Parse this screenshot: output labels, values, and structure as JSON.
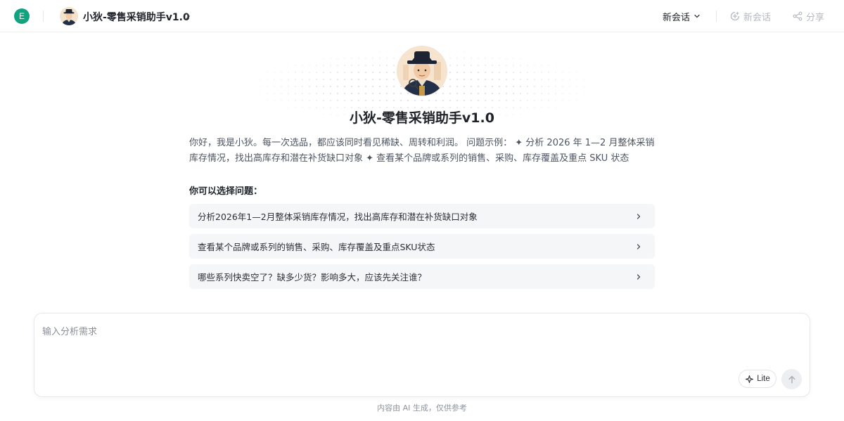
{
  "workspace": {
    "avatar_letter": "E",
    "accent": "#10a37f"
  },
  "bot": {
    "name": "小狄-零售采销助手v1.0"
  },
  "header": {
    "new_chat_dropdown_label": "新会话",
    "new_chat_button_label": "新会话",
    "share_label": "分享"
  },
  "hero": {
    "title": "小狄-零售采销助手v1.0",
    "intro": "你好，我是小狄。每一次选品，都应该同时看见稀缺、周转和利润。 问题示例： ✦ 分析 2026 年 1—2 月整体采销库存情况，找出高库存和潜在补货缺口对象 ✦ 查看某个品牌或系列的销售、采购、库存覆盖及重点 SKU 状态"
  },
  "questions": {
    "heading": "你可以选择问题：",
    "items": [
      {
        "label": "分析2026年1—2月整体采销库存情况，找出高库存和潜在补货缺口对象"
      },
      {
        "label": "查看某个品牌或系列的销售、采购、库存覆盖及重点SKU状态"
      },
      {
        "label": "哪些系列快卖空了？缺多少货？影响多大，应该先关注谁？"
      }
    ]
  },
  "composer": {
    "placeholder": "输入分析需求",
    "value": "",
    "mode_label": "Lite"
  },
  "footer": {
    "note": "内容由 AI 生成，仅供参考"
  },
  "icons": {
    "chevron": "chevron-right-icon",
    "dropdown": "chevron-down-icon",
    "new_chat": "new-chat-icon",
    "share": "share-icon",
    "sparkle": "sparkle-icon",
    "send": "arrow-up-icon"
  }
}
